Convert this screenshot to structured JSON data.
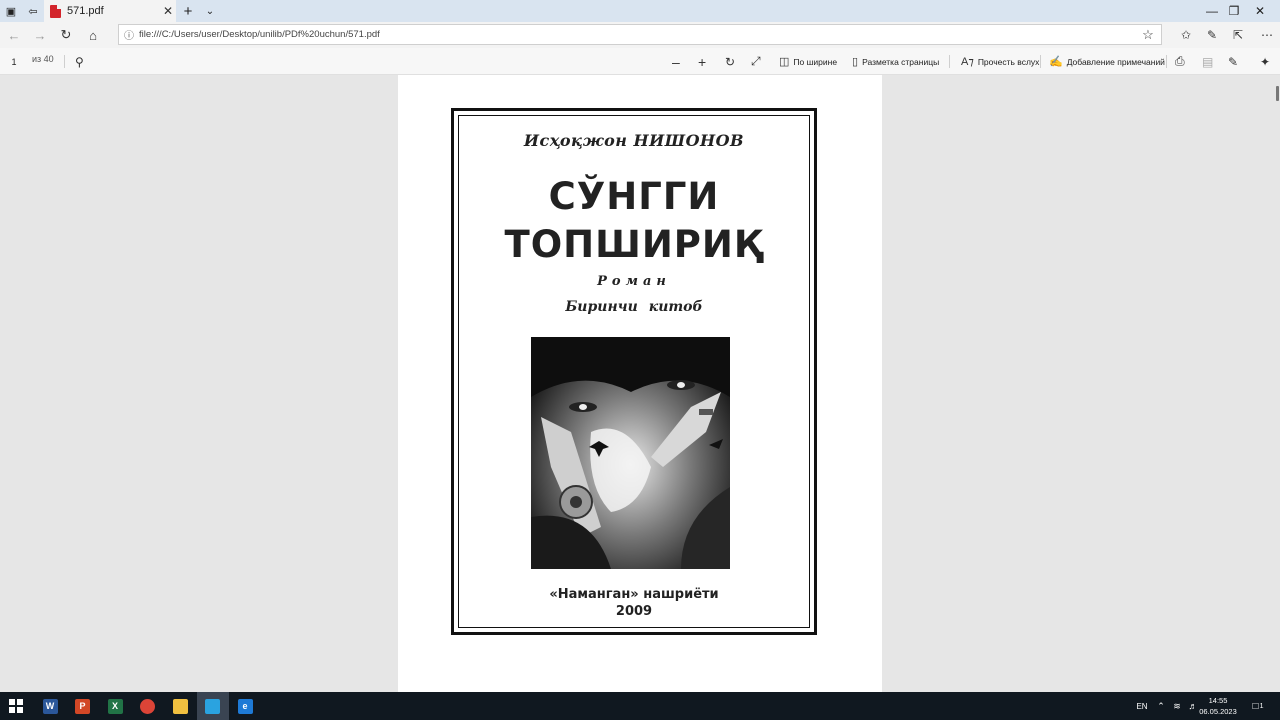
{
  "browser": {
    "tab_title": "571.pdf",
    "url": "file:///C:/Users/user/Desktop/unilib/PDf%20uchun/571.pdf"
  },
  "pdf_toolbar": {
    "page_current": "1",
    "page_of": "из 40",
    "fit_width": "По ширине",
    "page_layout": "Разметка страницы",
    "read_aloud": "Прочесть вслух",
    "add_notes": "Добавление примечаний"
  },
  "document": {
    "author": "Исҳоқжон НИШОНОВ",
    "title_line1": "СЎНГГИ",
    "title_line2": "ТОПШИРИҚ",
    "genre": "Роман",
    "book": "Биринчи китоб",
    "publisher": "«Наманган» нашриёти",
    "year": "2009"
  },
  "taskbar": {
    "apps": [
      {
        "name": "word",
        "glyph": "W",
        "color": "#2b579a"
      },
      {
        "name": "powerpoint",
        "glyph": "P",
        "color": "#d24726"
      },
      {
        "name": "excel",
        "glyph": "X",
        "color": "#217346"
      },
      {
        "name": "chrome",
        "glyph": "",
        "color": "#db4437"
      },
      {
        "name": "file-explorer",
        "glyph": "",
        "color": "#f0c040"
      },
      {
        "name": "telegram",
        "glyph": "",
        "color": "#2aa3e0"
      },
      {
        "name": "edge",
        "glyph": "e",
        "color": "#1e7ad6"
      }
    ],
    "language": "EN",
    "time": "14:55",
    "date": "06.05.2023",
    "notification_count": "1"
  }
}
